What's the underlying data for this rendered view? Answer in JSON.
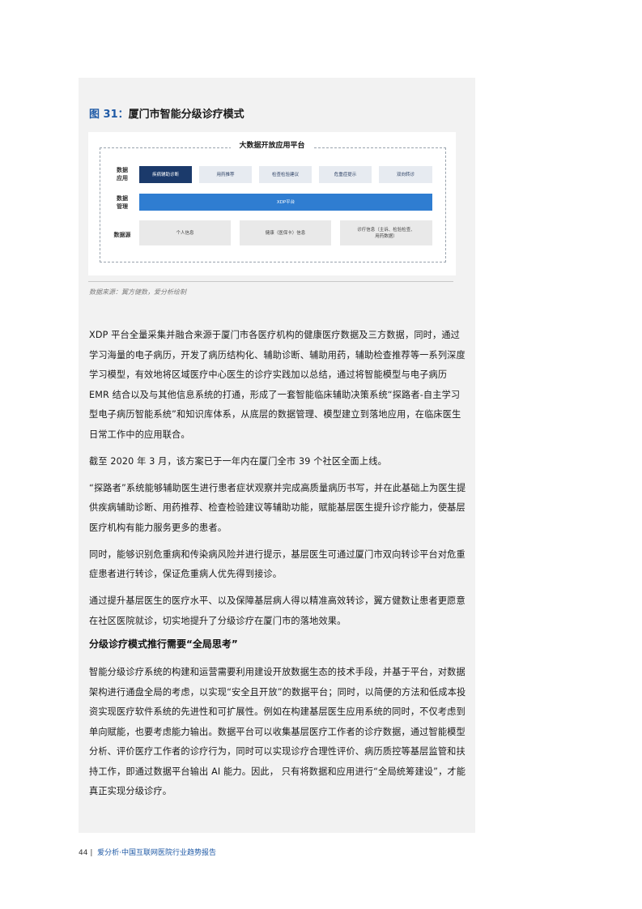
{
  "figure": {
    "number": "图 31：",
    "title": "厦门市智能分级诊疗模式",
    "diagram": {
      "platform_title": "大数据开放应用平台",
      "rows": {
        "data_application": {
          "label_line1": "数据",
          "label_line2": "应用",
          "boxes": [
            "疾病辅助诊断",
            "用药推荐",
            "检查检验建议",
            "危重症提示",
            "双向转诊"
          ]
        },
        "data_management": {
          "label_line1": "数据",
          "label_line2": "管理",
          "boxes": [
            "XDP平台"
          ]
        },
        "data_source": {
          "label": "数据源",
          "boxes": [
            "个人信息",
            "健康（医保卡）信息",
            "诊疗信息（主诉、检验检查、",
            "用药数据）"
          ]
        }
      }
    },
    "source": "数据来源：翼方健数，爱分析绘制"
  },
  "paragraphs": [
    "XDP 平台全量采集并融合来源于厦门市各医疗机构的健康医疗数据及三方数据，同时，通过学习海量的电子病历，开发了病历结构化、辅助诊断、辅助用药，辅助检查推荐等一系列深度学习模型，有效地将区域医疗中心医生的诊疗实践加以总结，通过将智能模型与电子病历 EMR 结合以及与其他信息系统的打通，形成了一套智能临床辅助决策系统“探路者-自主学习型电子病历智能系统”和知识库体系，从底层的数据管理、模型建立到落地应用，在临床医生日常工作中的应用联合。",
    "截至 2020 年 3 月，该方案已于一年内在厦门全市 39 个社区全面上线。",
    "“探路者”系统能够辅助医生进行患者症状观察并完成高质量病历书写，并在此基础上为医生提供疾病辅助诊断、用药推荐、检查检验建议等辅助功能，赋能基层医生提升诊疗能力，使基层医疗机构有能力服务更多的患者。",
    "同时，能够识别危重病和传染病风险并进行提示，基层医生可通过厦门市双向转诊平台对危重症患者进行转诊，保证危重病人优先得到接诊。",
    "通过提升基层医生的医疗水平、以及保障基层病人得以精准高效转诊，翼方健数让患者更愿意在社区医院就诊，切实地提升了分级诊疗在厦门市的落地效果。"
  ],
  "subheading": "分级诊疗模式推行需要“全局思考”",
  "paragraphs2": [
    "智能分级诊疗系统的构建和运营需要利用建设开放数据生态的技术手段，并基于平台，对数据架构进行通盘全局的考虑，以实现“安全且开放”的数据平台；同时，以简便的方法和低成本投资实现医疗软件系统的先进性和可扩展性。例如在构建基层医生应用系统的同时，不仅考虑到单向赋能，也要考虑能力输出。数据平台可以收集基层医疗工作者的诊疗数据，通过智能模型分析、评价医疗工作者的诊疗行为，同时可以实现诊疗合理性评价、病历质控等基层监管和扶持工作，即通过数据平台输出 AI 能力。因此， 只有将数据和应用进行“全局统筹建设”，才能真正实现分级诊疗。"
  ],
  "footer": {
    "page_number": "44 |",
    "text": "爱分析·中国互联网医院行业趋势报告"
  },
  "colors": {
    "accent": "#1f5aa6",
    "dark_box": "#1b3a6b",
    "xdp_bar": "#2f7dd1",
    "panel": "#f2f2f2"
  }
}
